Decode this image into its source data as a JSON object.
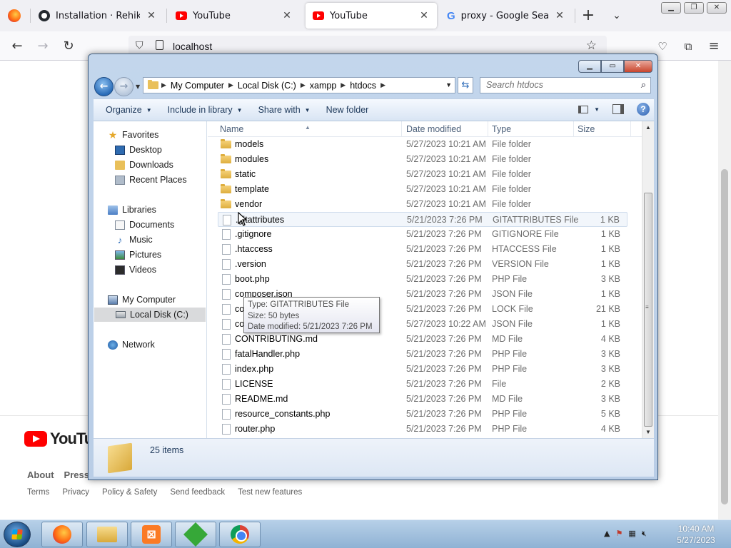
{
  "browser": {
    "tabs": [
      {
        "title": "Installation · Rehike/Rehike",
        "favicon": "github-icon",
        "active": false
      },
      {
        "title": "YouTube",
        "favicon": "youtube-icon",
        "active": false
      },
      {
        "title": "YouTube",
        "favicon": "youtube-icon",
        "active": true
      },
      {
        "title": "proxy - Google Search",
        "favicon": "google-icon",
        "active": false
      }
    ],
    "url": "localhost"
  },
  "page": {
    "logo_text": "YouTube",
    "footer_links_primary": [
      "About",
      "Press"
    ],
    "footer_links_secondary": [
      "Terms",
      "Privacy",
      "Policy & Safety",
      "Send feedback",
      "Test new features"
    ]
  },
  "explorer": {
    "breadcrumb": [
      "My Computer",
      "Local Disk (C:)",
      "xampp",
      "htdocs"
    ],
    "search_placeholder": "Search htdocs",
    "toolbar": {
      "organize": "Organize",
      "include": "Include in library",
      "share": "Share with",
      "new_folder": "New folder"
    },
    "nav_pane": {
      "favorites": "Favorites",
      "favorites_items": [
        "Desktop",
        "Downloads",
        "Recent Places"
      ],
      "libraries": "Libraries",
      "libraries_items": [
        "Documents",
        "Music",
        "Pictures",
        "Videos"
      ],
      "computer": "My Computer",
      "computer_items": [
        "Local Disk (C:)"
      ],
      "network": "Network"
    },
    "columns": [
      "Name",
      "Date modified",
      "Type",
      "Size"
    ],
    "files": [
      {
        "name": "models",
        "date": "5/27/2023 10:21 AM",
        "type": "File folder",
        "size": "",
        "kind": "folder"
      },
      {
        "name": "modules",
        "date": "5/27/2023 10:21 AM",
        "type": "File folder",
        "size": "",
        "kind": "folder"
      },
      {
        "name": "static",
        "date": "5/27/2023 10:21 AM",
        "type": "File folder",
        "size": "",
        "kind": "folder"
      },
      {
        "name": "template",
        "date": "5/27/2023 10:21 AM",
        "type": "File folder",
        "size": "",
        "kind": "folder"
      },
      {
        "name": "vendor",
        "date": "5/27/2023 10:21 AM",
        "type": "File folder",
        "size": "",
        "kind": "folder"
      },
      {
        "name": ".gitattributes",
        "date": "5/21/2023 7:26 PM",
        "type": "GITATTRIBUTES File",
        "size": "1 KB",
        "kind": "file"
      },
      {
        "name": ".gitignore",
        "date": "5/21/2023 7:26 PM",
        "type": "GITIGNORE File",
        "size": "1 KB",
        "kind": "file"
      },
      {
        "name": ".htaccess",
        "date": "5/21/2023 7:26 PM",
        "type": "HTACCESS File",
        "size": "1 KB",
        "kind": "file"
      },
      {
        "name": ".version",
        "date": "5/21/2023 7:26 PM",
        "type": "VERSION File",
        "size": "1 KB",
        "kind": "file"
      },
      {
        "name": "boot.php",
        "date": "5/21/2023 7:26 PM",
        "type": "PHP File",
        "size": "3 KB",
        "kind": "file"
      },
      {
        "name": "composer.json",
        "date": "5/21/2023 7:26 PM",
        "type": "JSON File",
        "size": "1 KB",
        "kind": "file"
      },
      {
        "name": "composer.lock",
        "date": "5/21/2023 7:26 PM",
        "type": "LOCK File",
        "size": "21 KB",
        "kind": "file"
      },
      {
        "name": "config.json",
        "date": "5/27/2023 10:22 AM",
        "type": "JSON File",
        "size": "1 KB",
        "kind": "file"
      },
      {
        "name": "CONTRIBUTING.md",
        "date": "5/21/2023 7:26 PM",
        "type": "MD File",
        "size": "4 KB",
        "kind": "file"
      },
      {
        "name": "fatalHandler.php",
        "date": "5/21/2023 7:26 PM",
        "type": "PHP File",
        "size": "3 KB",
        "kind": "file"
      },
      {
        "name": "index.php",
        "date": "5/21/2023 7:26 PM",
        "type": "PHP File",
        "size": "3 KB",
        "kind": "file"
      },
      {
        "name": "LICENSE",
        "date": "5/21/2023 7:26 PM",
        "type": "File",
        "size": "2 KB",
        "kind": "file"
      },
      {
        "name": "README.md",
        "date": "5/21/2023 7:26 PM",
        "type": "MD File",
        "size": "3 KB",
        "kind": "file"
      },
      {
        "name": "resource_constants.php",
        "date": "5/21/2023 7:26 PM",
        "type": "PHP File",
        "size": "5 KB",
        "kind": "file"
      },
      {
        "name": "router.php",
        "date": "5/21/2023 7:26 PM",
        "type": "PHP File",
        "size": "4 KB",
        "kind": "file"
      }
    ],
    "tooltip": {
      "type": "Type: GITATTRIBUTES File",
      "size": "Size: 50 bytes",
      "modified": "Date modified: 5/21/2023 7:26 PM"
    },
    "item_count": "25 items"
  },
  "taskbar": {
    "time": "10:40 AM",
    "date": "5/27/2023"
  }
}
